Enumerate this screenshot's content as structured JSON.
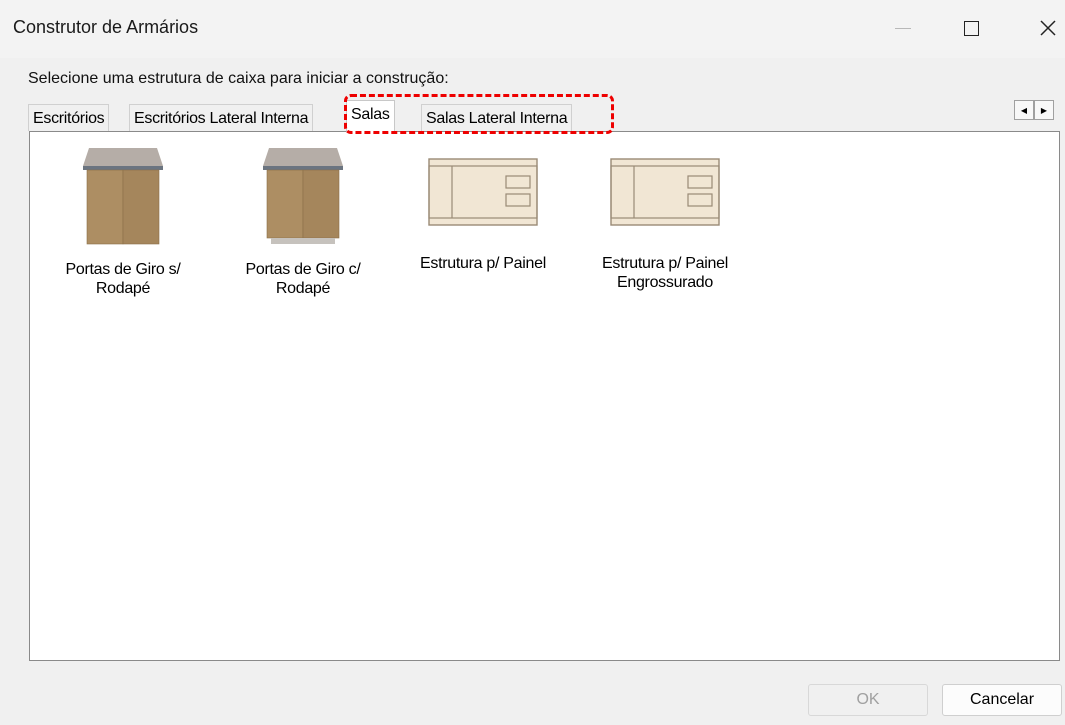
{
  "window": {
    "title": "Construtor de Armários",
    "minimize_icon": "minimize-icon",
    "maximize_icon": "maximize-icon",
    "close_glyph": "✕"
  },
  "prompt": "Selecione uma estrutura de caixa para iniciar a construção:",
  "tabs": [
    {
      "label": "Escritórios",
      "active": false
    },
    {
      "label": "Escritórios Lateral Interna",
      "active": false
    },
    {
      "label": "Salas",
      "active": true
    },
    {
      "label": "Salas Lateral Interna",
      "active": false
    }
  ],
  "tab_scroll": {
    "left": "◀",
    "right": "▶"
  },
  "items": [
    {
      "line1": "Portas de Giro s/",
      "line2": "Rodapé",
      "icon": "cabinet-icon"
    },
    {
      "line1": "Portas de Giro c/",
      "line2": "Rodapé",
      "icon": "cabinet-icon"
    },
    {
      "line1": "Estrutura p/ Painel",
      "line2": "",
      "icon": "panel-structure-icon"
    },
    {
      "line1": "Estrutura p/ Painel",
      "line2": "Engrossurado",
      "icon": "panel-structure-icon"
    }
  ],
  "buttons": {
    "ok": "OK",
    "cancel": "Cancelar"
  },
  "colors": {
    "highlight": "#e00000",
    "wood": "#a8895f",
    "panel": "#f1e6d4"
  }
}
